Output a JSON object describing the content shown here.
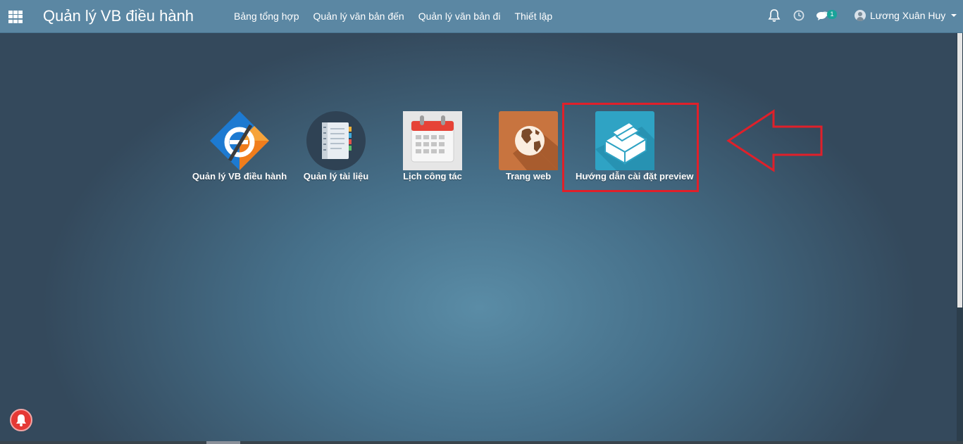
{
  "header": {
    "app_title": "Quản lý VB điều hành",
    "menu": [
      "Bảng tổng hợp",
      "Quản lý văn bản đến",
      "Quản lý văn bản đi",
      "Thiết lập"
    ],
    "chat_badge": "1",
    "user_name": "Lương Xuân Huy"
  },
  "apps": [
    {
      "label": "Quản lý VB điều hành",
      "icon": "e-office-icon"
    },
    {
      "label": "Quản lý tài liệu",
      "icon": "notebook-icon"
    },
    {
      "label": "Lịch công tác",
      "icon": "calendar-icon"
    },
    {
      "label": "Trang web",
      "icon": "globe-icon"
    },
    {
      "label": "Hướng dẫn cài đặt preview",
      "icon": "file-box-icon"
    }
  ],
  "colors": {
    "navbar": "#5b87a3",
    "highlight": "#e0202a",
    "notify": "#e53935"
  }
}
